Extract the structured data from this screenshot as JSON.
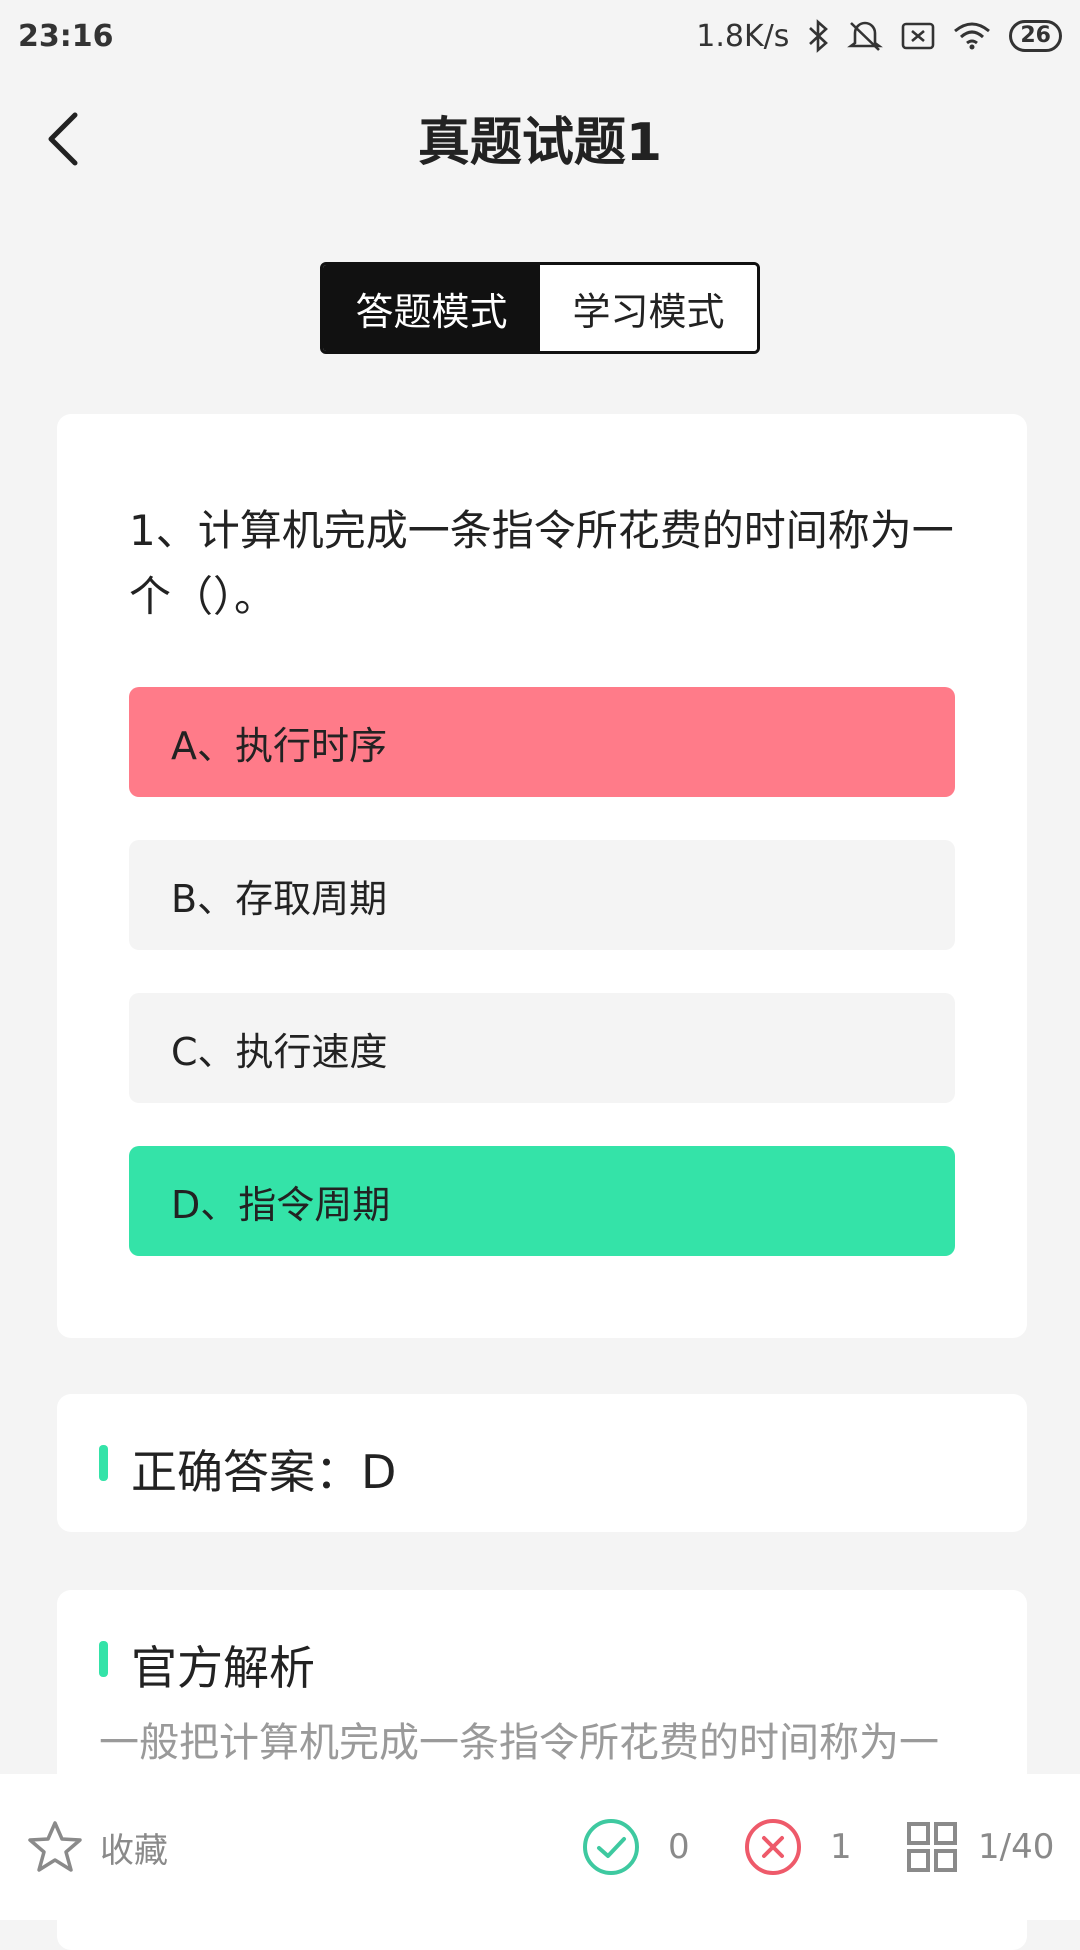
{
  "status_bar": {
    "time": "23:16",
    "net_speed": "1.8K/s",
    "battery": "26",
    "icons": [
      "bluetooth-icon",
      "mute-icon",
      "sim-icon",
      "wifi-icon",
      "battery-icon"
    ]
  },
  "header": {
    "title": "真题试题1",
    "back_icon": "back-chevron-icon"
  },
  "mode_toggle": {
    "active": "答题模式",
    "inactive": "学习模式"
  },
  "question": {
    "text": "1、计算机完成一条指令所花费的时间称为一个（）。",
    "options": [
      {
        "label": "A、执行时序",
        "state": "wrong",
        "color": "#ff7b89"
      },
      {
        "label": "B、存取周期",
        "state": "normal",
        "color": "#f4f4f4"
      },
      {
        "label": "C、执行速度",
        "state": "normal",
        "color": "#f4f4f4"
      },
      {
        "label": "D、指令周期",
        "state": "correct",
        "color": "#34e3a8"
      }
    ]
  },
  "answer": {
    "label": "正确答案：D"
  },
  "analysis": {
    "title": "官方解析",
    "text": "一般把计算机完成一条指令所花费的时间称为一"
  },
  "bottom_bar": {
    "favorite_label": "收藏",
    "correct_count": "0",
    "wrong_count": "1",
    "progress": "1/40"
  },
  "colors": {
    "accent_green": "#34e3a8",
    "wrong_red": "#ff7b89",
    "correct_icon": "#3ec9a0",
    "wrong_icon": "#ee5a6a"
  }
}
